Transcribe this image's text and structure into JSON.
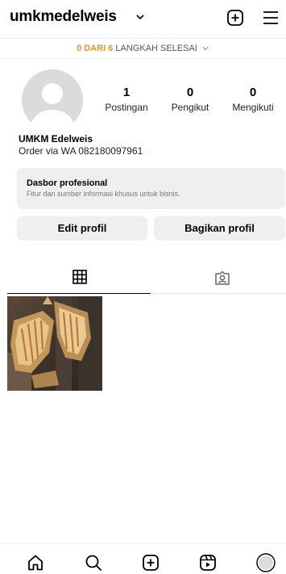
{
  "header": {
    "username": "umkmedelweis"
  },
  "setup_banner": {
    "count_text": "0 DARI 6",
    "rest_text": " LANGKAH SELESAI"
  },
  "profile": {
    "stats": [
      {
        "value": "1",
        "label": "Postingan"
      },
      {
        "value": "0",
        "label": "Pengikut"
      },
      {
        "value": "0",
        "label": "Mengikuti"
      }
    ],
    "name": "UMKM Edelweis",
    "bio": "Order via WA 082180097961"
  },
  "dashboard": {
    "title": "Dasbor profesional",
    "subtitle": "Fitur dan sumber informasi khusus untuk bisnis."
  },
  "buttons": {
    "edit": "Edit profil",
    "share": "Bagikan profil"
  },
  "tabs": [
    {
      "icon": "grid-icon",
      "active": true
    },
    {
      "icon": "tagged-icon",
      "active": false
    }
  ],
  "posts_count": 1,
  "bottom_nav": [
    "home-icon",
    "search-icon",
    "create-icon",
    "reels-icon",
    "profile-avatar"
  ]
}
